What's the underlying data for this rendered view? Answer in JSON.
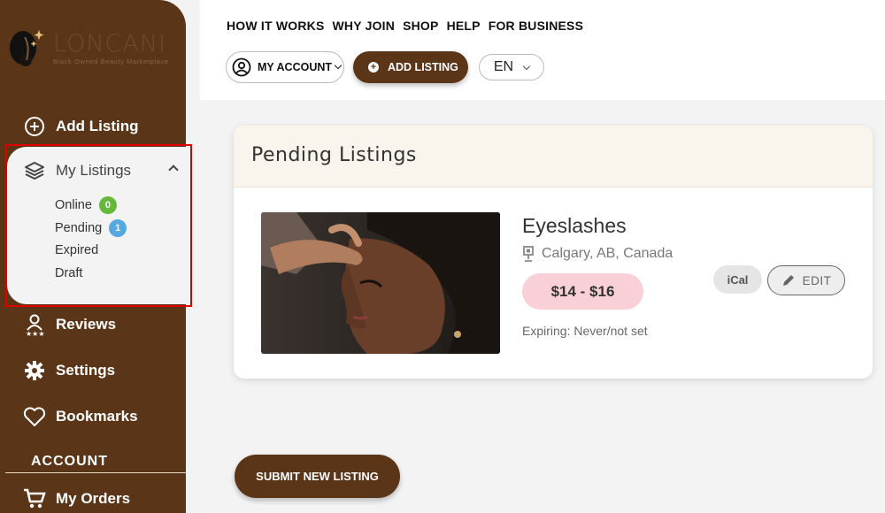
{
  "brand": {
    "name": "LONCANI",
    "tagline": "Black Owned Beauty Marketplace"
  },
  "sidebar": {
    "add_listing": "Add Listing",
    "my_listings": {
      "label": "My Listings",
      "items": [
        {
          "label": "Online",
          "count": "0"
        },
        {
          "label": "Pending",
          "count": "1"
        },
        {
          "label": "Expired"
        },
        {
          "label": "Draft"
        }
      ]
    },
    "reviews": "Reviews",
    "settings": "Settings",
    "bookmarks": "Bookmarks",
    "account_section": "ACCOUNT",
    "my_orders": "My Orders"
  },
  "header": {
    "nav": [
      "HOW IT WORKS",
      "WHY JOIN",
      "SHOP",
      "HELP",
      "FOR BUSINESS"
    ],
    "my_account": "MY ACCOUNT",
    "add_listing": "ADD LISTING",
    "language": "EN"
  },
  "main": {
    "panel_title": "Pending Listings",
    "listing": {
      "title": "Eyeslashes",
      "location": "Calgary, AB, Canada",
      "price": "$14 - $16",
      "expiring": "Expiring: Never/not set",
      "ical": "iCal",
      "edit": "EDIT"
    },
    "submit": "SUBMIT NEW LISTING"
  },
  "colors": {
    "brand_brown": "#5a3518",
    "price_pill": "#f9d0d7",
    "online_badge": "#64b83a",
    "pending_badge": "#55a9e0",
    "highlight": "#e00000"
  }
}
